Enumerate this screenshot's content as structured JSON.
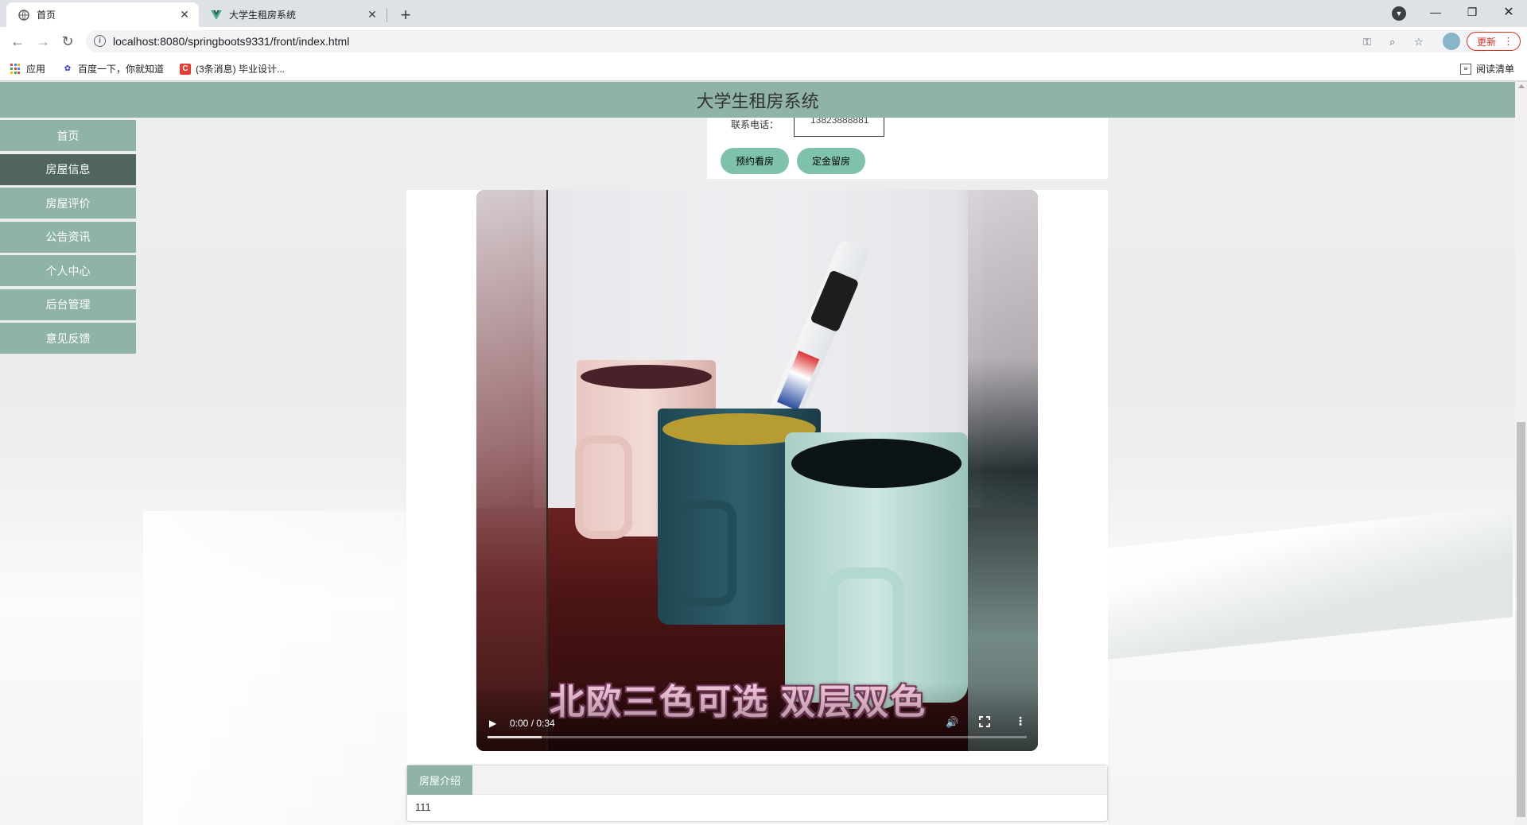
{
  "browser": {
    "tabs": [
      {
        "title": "首页",
        "active": true
      },
      {
        "title": "大学生租房系统",
        "active": false
      }
    ],
    "url": "localhost:8080/springboots9331/front/index.html",
    "update_label": "更新",
    "bookmarks": [
      {
        "label": "应用",
        "icon": "apps-grid-icon"
      },
      {
        "label": "百度一下，你就知道",
        "icon": "baidu-paw-icon"
      },
      {
        "label": "(3条消息) 毕业设计...",
        "icon": "csdn-icon"
      }
    ],
    "reading_list": "阅读清单"
  },
  "site": {
    "title": "大学生租房系统",
    "accent_color": "#8fb3a6",
    "active_color": "#4f655d"
  },
  "sidebar": {
    "items": [
      {
        "label": "首页",
        "active": false
      },
      {
        "label": "房屋信息",
        "active": true
      },
      {
        "label": "房屋评价",
        "active": false
      },
      {
        "label": "公告资讯",
        "active": false
      },
      {
        "label": "个人中心",
        "active": false
      },
      {
        "label": "后台管理",
        "active": false
      },
      {
        "label": "意见反馈",
        "active": false
      }
    ]
  },
  "detail": {
    "phone_label": "联系电话：",
    "phone_value": "13823888881",
    "buttons": {
      "book_viewing": "预约看房",
      "deposit": "定金留房"
    }
  },
  "video": {
    "caption": "北欧三色可选  双层双色",
    "time": "0:00 / 0:34",
    "buffered_fraction": 0.1
  },
  "intro": {
    "tab_label": "房屋介绍",
    "content": "111"
  }
}
